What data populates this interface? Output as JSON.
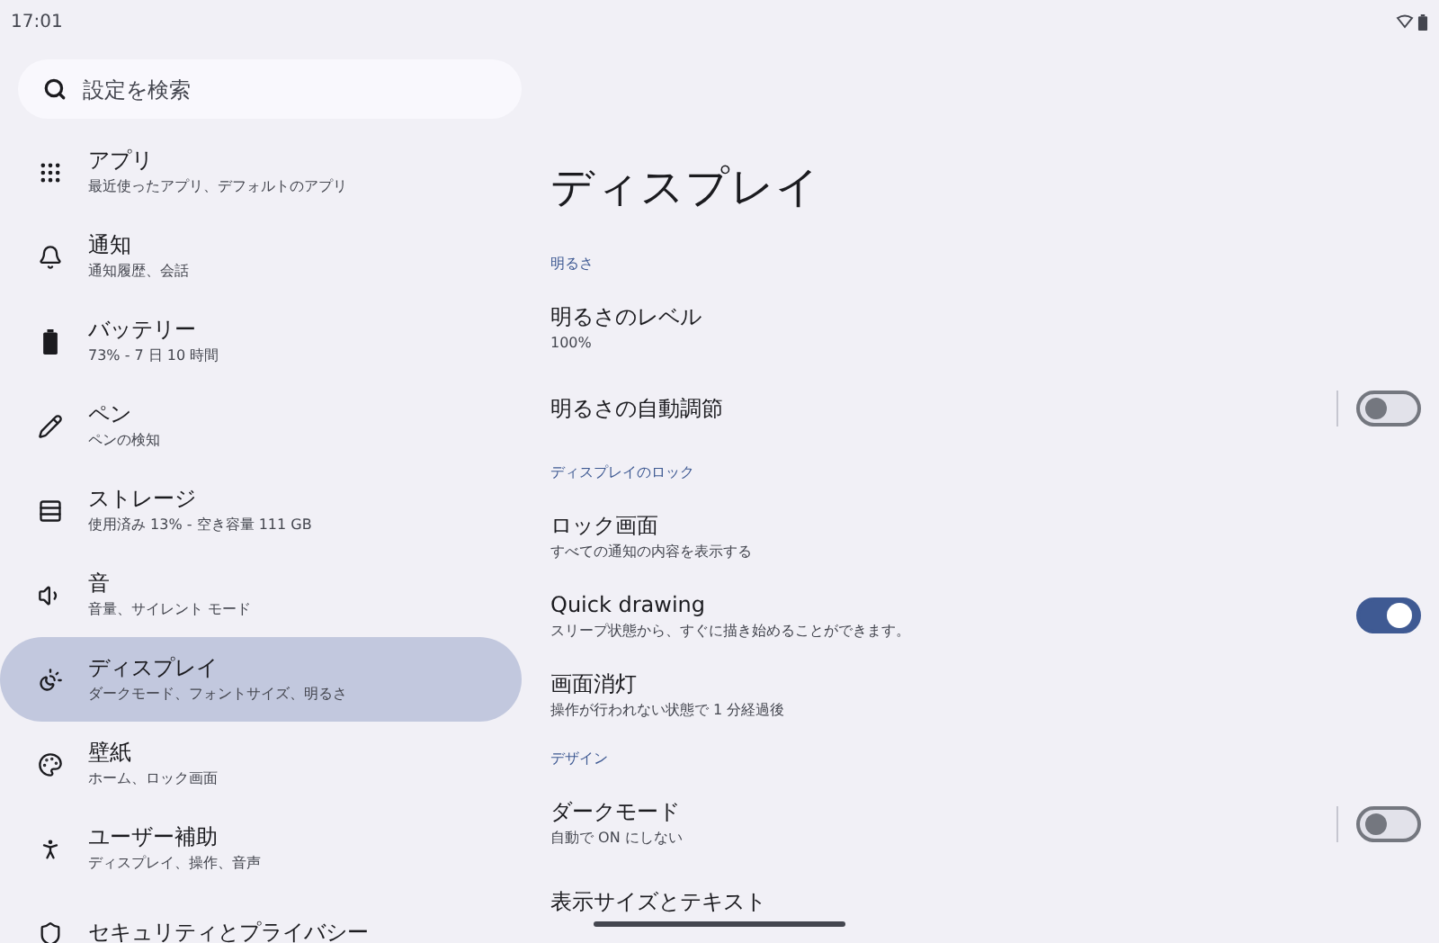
{
  "status_bar": {
    "time": "17:01"
  },
  "search": {
    "placeholder": "設定を検索"
  },
  "sidebar": {
    "items": [
      {
        "kind": "apps",
        "title": "アプリ",
        "subtitle": "最近使ったアプリ、デフォルトのアプリ",
        "selected": false
      },
      {
        "kind": "notifications",
        "title": "通知",
        "subtitle": "通知履歴、会話",
        "selected": false
      },
      {
        "kind": "battery",
        "title": "バッテリー",
        "subtitle": "73% - 7 日 10 時間",
        "selected": false
      },
      {
        "kind": "pen",
        "title": "ペン",
        "subtitle": "ペンの検知",
        "selected": false
      },
      {
        "kind": "storage",
        "title": "ストレージ",
        "subtitle": "使用済み 13% - 空き容量 111 GB",
        "selected": false
      },
      {
        "kind": "sound",
        "title": "音",
        "subtitle": "音量、サイレント モード",
        "selected": false
      },
      {
        "kind": "display",
        "title": "ディスプレイ",
        "subtitle": "ダークモード、フォントサイズ、明るさ",
        "selected": true
      },
      {
        "kind": "wallpaper",
        "title": "壁紙",
        "subtitle": "ホーム、ロック画面",
        "selected": false
      },
      {
        "kind": "accessibility",
        "title": "ユーザー補助",
        "subtitle": "ディスプレイ、操作、音声",
        "selected": false
      },
      {
        "kind": "security",
        "title": "セキュリティとプライバシー",
        "selected": false
      }
    ]
  },
  "page": {
    "title": "ディスプレイ",
    "rows": [
      {
        "kind": "header",
        "title": "明るさ"
      },
      {
        "kind": "item",
        "title": "明るさのレベル",
        "subtitle": "100%"
      },
      {
        "kind": "switch",
        "title": "明るさの自動調節",
        "on": false,
        "divider": true
      },
      {
        "kind": "header",
        "title": "ディスプレイのロック"
      },
      {
        "kind": "item",
        "title": "ロック画面",
        "subtitle": "すべての通知の内容を表示する"
      },
      {
        "kind": "switch",
        "title": "Quick drawing",
        "subtitle": "スリープ状態から、すぐに描き始めることができます。",
        "on": true,
        "divider": false
      },
      {
        "kind": "item",
        "title": "画面消灯",
        "subtitle": "操作が行われない状態で 1 分経過後"
      },
      {
        "kind": "header",
        "title": "デザイン"
      },
      {
        "kind": "switch",
        "title": "ダークモード",
        "subtitle": "自動で ON にしない",
        "on": false,
        "divider": true
      },
      {
        "kind": "item",
        "title": "表示サイズとテキスト"
      }
    ]
  }
}
